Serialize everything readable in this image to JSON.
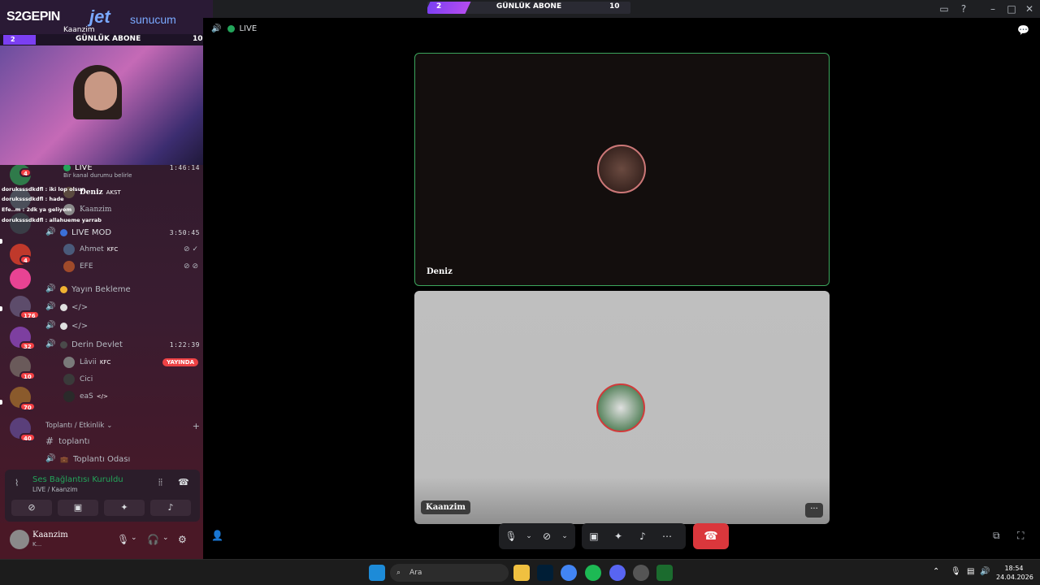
{
  "titlebar": {
    "goal_current": "2",
    "goal_label": "GÜNLÜK ABONE",
    "goal_target": "10",
    "goal_progress": 0.2
  },
  "overlay": {
    "logo_text": "S2GEPIN",
    "sponsor_jet": "jet",
    "sponsor_sunucum": "sunucum",
    "username": "Kaanzim",
    "goal_current": "2",
    "goal_label": "GÜNLÜK ABONE",
    "goal_target": "10"
  },
  "chat_lines": [
    {
      "text": "doruksssdkdfl : iki lop olsun"
    },
    {
      "text": "doruksssdkdfl : hade"
    },
    {
      "text": "Efe..m : 2dk ya geliyom"
    },
    {
      "text": "doruksssdkdfl : allahueme yarrab"
    }
  ],
  "rail_badges": [
    "4",
    "4",
    "176",
    "32",
    "10",
    "70",
    "40"
  ],
  "channels": {
    "live": {
      "name": "LIVE",
      "time": "1:46:14",
      "status": "Bir kanal durumu belirle"
    },
    "live_members": [
      {
        "name": "Deniz",
        "tag": "AKST"
      },
      {
        "name": "Kaanzim",
        "tag": ""
      }
    ],
    "live_mod": {
      "name": "LIVE MOD",
      "time": "3:50:45"
    },
    "live_mod_members": [
      {
        "name": "Ahmet",
        "tag": "KFC"
      },
      {
        "name": "EFE",
        "tag": ""
      }
    ],
    "yayin_bekleme": {
      "name": "Yayın Bekleme"
    },
    "code1": {
      "name": "</>"
    },
    "code2": {
      "name": "</>"
    },
    "derin_devlet": {
      "name": "Derin Devlet",
      "time": "1:22:39"
    },
    "derin_members": [
      {
        "name": "Lâvii",
        "tag": "KFC",
        "badge": "YAYINDA"
      },
      {
        "name": "Cici",
        "tag": ""
      },
      {
        "name": "eaS",
        "tag": "</>"
      }
    ],
    "category": "Toplantı / Etkinlik",
    "toplanti_text": "toplantı",
    "toplanti_odasi": "Toplantı Odası"
  },
  "voice_panel": {
    "title": "Ses Bağlantısı Kuruldu",
    "subtitle": "LIVE / Kaanzim"
  },
  "user": {
    "name": "Kaanzim",
    "status": "K..."
  },
  "stage": {
    "channel_label": "LIVE",
    "tile1_name": "Deniz",
    "tile2_name": "Kaanzim",
    "more_label": "···"
  },
  "taskbar": {
    "search_placeholder": "Ara",
    "time": "18:54",
    "date": "24.04.2026"
  },
  "colors": {
    "accent_green": "#23a55a",
    "hangup_red": "#da373c",
    "live_badge": "#ed4245",
    "goal_purple": "#7b3ff2"
  }
}
